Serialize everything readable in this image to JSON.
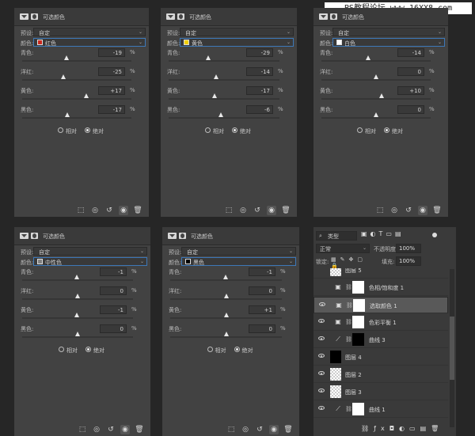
{
  "watermark": "PS教程论坛 www.16XX8.com",
  "panels": [
    {
      "title": "可选颜色",
      "preset_label": "预设:",
      "preset_value": "自定",
      "color_label": "颜色:",
      "color_value": "红色",
      "color_swatch": "#c8281e",
      "rows": [
        {
          "label": "青色:",
          "value": "-19",
          "unit": "%",
          "level": -19
        },
        {
          "label": "洋红:",
          "value": "-25",
          "unit": "%",
          "level": -25
        },
        {
          "label": "黄色:",
          "value": "+17",
          "unit": "%",
          "level": 17
        },
        {
          "label": "黑色:",
          "value": "-17",
          "unit": "%",
          "level": -17
        }
      ],
      "method_relative": "相对",
      "method_absolute": "绝对",
      "absolute_selected": true
    },
    {
      "title": "可选颜色",
      "preset_label": "预设:",
      "preset_value": "自定",
      "color_label": "颜色:",
      "color_value": "黄色",
      "color_swatch": "#f0d000",
      "rows": [
        {
          "label": "青色:",
          "value": "-29",
          "unit": "%",
          "level": -29
        },
        {
          "label": "洋红:",
          "value": "-14",
          "unit": "%",
          "level": -14
        },
        {
          "label": "黄色:",
          "value": "-17",
          "unit": "%",
          "level": -17
        },
        {
          "label": "黑色:",
          "value": "-6",
          "unit": "%",
          "level": -6
        }
      ],
      "method_relative": "相对",
      "method_absolute": "绝对",
      "absolute_selected": true
    },
    {
      "title": "可选颜色",
      "preset_label": "预设:",
      "preset_value": "自定",
      "color_label": "颜色:",
      "color_value": "白色",
      "color_swatch": "#ffffff",
      "rows": [
        {
          "label": "青色:",
          "value": "-14",
          "unit": "%",
          "level": -14
        },
        {
          "label": "洋红:",
          "value": "0",
          "unit": "%",
          "level": 0
        },
        {
          "label": "黄色:",
          "value": "+10",
          "unit": "%",
          "level": 10
        },
        {
          "label": "黑色:",
          "value": "0",
          "unit": "%",
          "level": 0
        }
      ],
      "method_relative": "相对",
      "method_absolute": "绝对",
      "absolute_selected": true
    },
    {
      "title": "可选颜色",
      "preset_label": "预设:",
      "preset_value": "自定",
      "color_label": "颜色:",
      "color_value": "中性色",
      "color_swatch": "#808080",
      "rows": [
        {
          "label": "青色:",
          "value": "-1",
          "unit": "%",
          "level": -1
        },
        {
          "label": "洋红:",
          "value": "0",
          "unit": "%",
          "level": 0
        },
        {
          "label": "黄色:",
          "value": "-1",
          "unit": "%",
          "level": -1
        },
        {
          "label": "黑色:",
          "value": "0",
          "unit": "%",
          "level": 0
        }
      ],
      "method_relative": "相对",
      "method_absolute": "绝对",
      "absolute_selected": true
    },
    {
      "title": "可选颜色",
      "preset_label": "预设:",
      "preset_value": "自定",
      "color_label": "颜色:",
      "color_value": "黑色",
      "color_swatch": "#000000",
      "rows": [
        {
          "label": "青色:",
          "value": "-1",
          "unit": "%",
          "level": -1
        },
        {
          "label": "洋红:",
          "value": "0",
          "unit": "%",
          "level": 0
        },
        {
          "label": "黄色:",
          "value": "+1",
          "unit": "%",
          "level": 1
        },
        {
          "label": "黑色:",
          "value": "0",
          "unit": "%",
          "level": 0
        }
      ],
      "method_relative": "相对",
      "method_absolute": "绝对",
      "absolute_selected": true
    }
  ],
  "layers_panel": {
    "filter_label": "类型",
    "blend_mode": "正常",
    "opacity_label": "不透明度:",
    "opacity_value": "100%",
    "lock_label": "锁定:",
    "fill_label": "填充:",
    "fill_value": "100%",
    "layers": [
      {
        "name": "图层 5",
        "visible": false,
        "kind": "pixel"
      },
      {
        "name": "色相/饱和度 1",
        "visible": false,
        "kind": "adjustment"
      },
      {
        "name": "选取颜色 1",
        "visible": true,
        "kind": "adjustment",
        "selected": true
      },
      {
        "name": "色彩平衡 1",
        "visible": true,
        "kind": "adjustment"
      },
      {
        "name": "曲线 3",
        "visible": true,
        "kind": "curves"
      },
      {
        "name": "图层 4",
        "visible": true,
        "kind": "pixel-black"
      },
      {
        "name": "图层 2",
        "visible": true,
        "kind": "pixel"
      },
      {
        "name": "图层 3",
        "visible": true,
        "kind": "pixel"
      },
      {
        "name": "曲线 1",
        "visible": true,
        "kind": "curves"
      }
    ]
  }
}
